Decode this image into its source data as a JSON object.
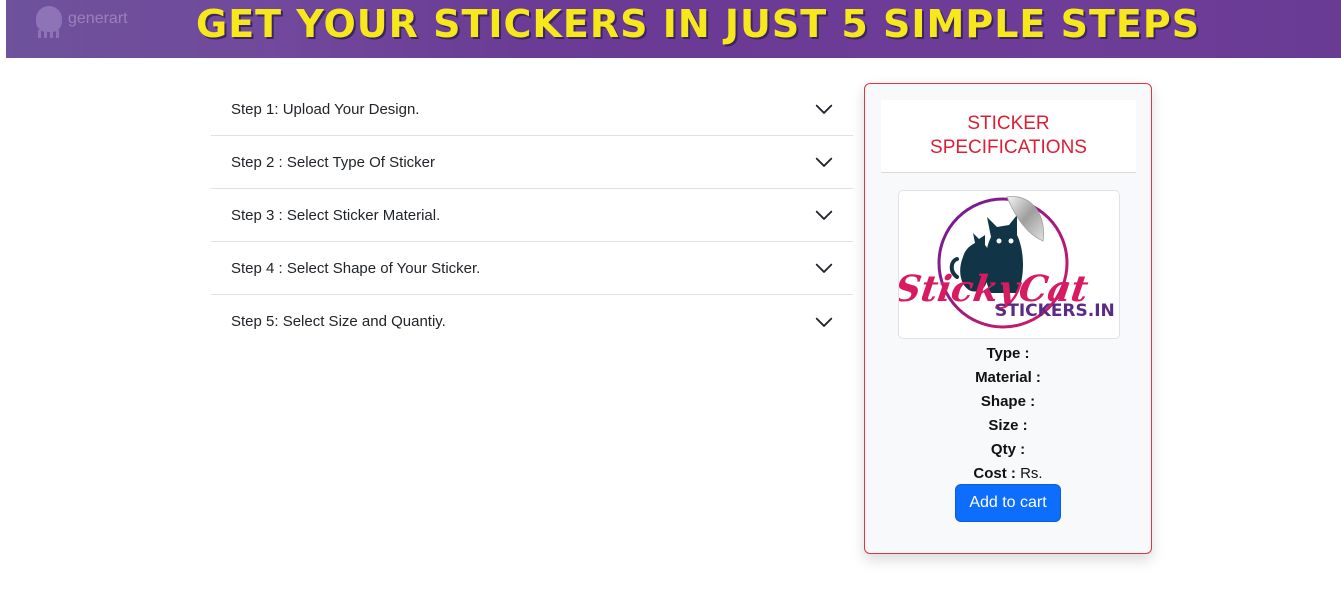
{
  "banner": {
    "brand": "generart",
    "title": "GET YOUR STICKERS IN JUST 5 SIMPLE STEPS"
  },
  "steps": [
    {
      "label": "Step 1: Upload Your Design."
    },
    {
      "label": "Step 2 : Select Type Of Sticker"
    },
    {
      "label": "Step 3 : Select Sticker Material."
    },
    {
      "label": "Step 4 : Select Shape of Your Sticker."
    },
    {
      "label": "Step 5: Select Size and Quantiy."
    }
  ],
  "specs": {
    "title": "STICKER SPECIFICATIONS",
    "logo": {
      "line1": "StickyCat",
      "line2": "STICKERS.IN"
    },
    "rows": [
      {
        "key": "Type :",
        "value": ""
      },
      {
        "key": "Material :",
        "value": ""
      },
      {
        "key": "Shape :",
        "value": ""
      },
      {
        "key": "Size :",
        "value": ""
      },
      {
        "key": "Qty :",
        "value": ""
      },
      {
        "key": "Cost :",
        "value": "Rs."
      }
    ],
    "add_to_cart": "Add to cart"
  },
  "colors": {
    "banner_text": "#f6e81b",
    "banner_bg": "#6a3f97",
    "accent_red": "#dc1f35",
    "primary_button": "#0d6efd"
  },
  "icons": {
    "accordion_toggle": "chevron-down-icon",
    "banner_logo": "octopus-icon"
  }
}
